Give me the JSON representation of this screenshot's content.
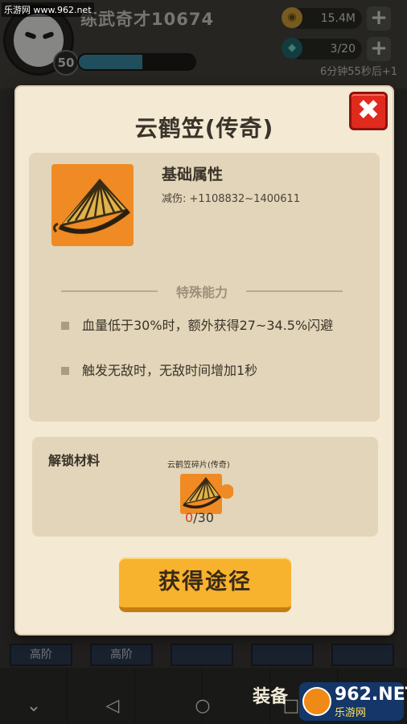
{
  "watermark": {
    "top_left": "乐游网 www.962.net"
  },
  "player": {
    "name": "练武奇才10674",
    "level": "50",
    "xp_fraction": 0.55
  },
  "resources": {
    "gold": "15.4M",
    "gems": "3/20",
    "regen_timer": "6分钟55秒后+1"
  },
  "modal": {
    "title": "云鹤笠(传奇)",
    "close_icon": "close-x-icon",
    "basic_attributes": {
      "heading": "基础属性",
      "stat": "减伤: +1108832~1400611"
    },
    "special": {
      "heading": "特殊能力",
      "abilities": [
        "血量低于30%时，额外获得27~34.5%闪避",
        "触发无敌时，无敌时间增加1秒"
      ]
    },
    "unlock": {
      "heading": "解锁材料",
      "material_name": "云鹤笠碎片(传奇)",
      "have": "0",
      "need": "/30"
    },
    "action_button": "获得途径"
  },
  "background_tabs": [
    "高阶",
    "高阶"
  ],
  "bottom_nav": {
    "label": "装备"
  },
  "brand": {
    "number": "962.NET",
    "sub": "乐游网"
  },
  "colors": {
    "modal_bg": "#f4ead4",
    "panel_bg": "#e2d5b9",
    "legendary_orange": "#ef8a24",
    "button_yellow": "#f7b22e",
    "close_red": "#e02a1e"
  }
}
